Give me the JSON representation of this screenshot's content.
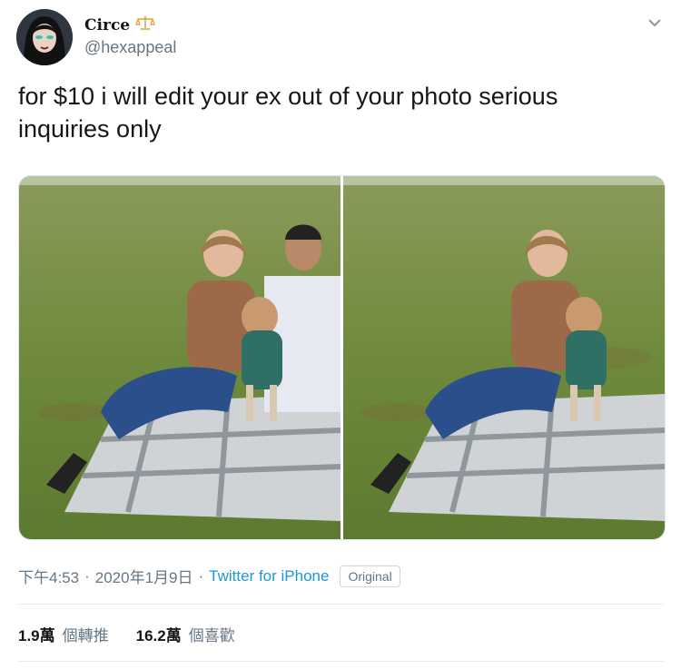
{
  "user": {
    "display_name": "Circe",
    "handle": "@hexappeal",
    "badge_icon": "scales-icon"
  },
  "tweet": {
    "text": "for $10 i will edit your ex out of your photo serious inquiries only"
  },
  "meta": {
    "time": "下午4:53",
    "sep1": "·",
    "date": "2020年1月9日",
    "sep2": "·",
    "source": "Twitter for iPhone",
    "badge": "Original"
  },
  "stats": {
    "retweets_count": "1.9萬",
    "retweets_label": "個轉推",
    "likes_count": "16.2萬",
    "likes_label": "個喜歡"
  },
  "colors": {
    "link": "#1b95e0",
    "muted": "#657786",
    "text": "#14171a"
  }
}
